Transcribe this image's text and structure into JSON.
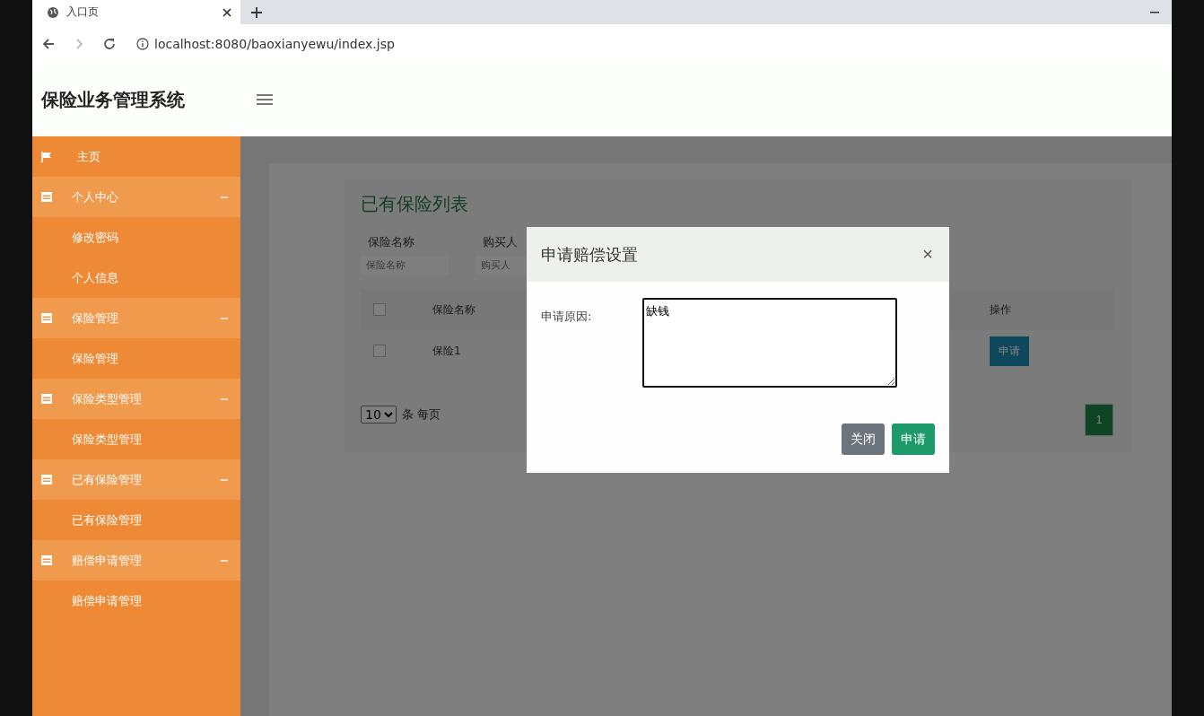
{
  "browser": {
    "tab_title": "入口页",
    "url": "localhost:8080/baoxianyewu/index.jsp"
  },
  "app_title": "保险业务管理系统",
  "sidebar": [
    {
      "label": "主页",
      "kind": "link"
    },
    {
      "label": "个人中心",
      "kind": "group",
      "expanded": true,
      "children": [
        {
          "label": "修改密码"
        },
        {
          "label": "个人信息"
        }
      ]
    },
    {
      "label": "保险管理",
      "kind": "group",
      "expanded": true,
      "children": [
        {
          "label": "保险管理"
        }
      ]
    },
    {
      "label": "保险类型管理",
      "kind": "group",
      "expanded": true,
      "children": [
        {
          "label": "保险类型管理"
        }
      ]
    },
    {
      "label": "已有保险管理",
      "kind": "group",
      "expanded": true,
      "children": [
        {
          "label": "已有保险管理"
        }
      ]
    },
    {
      "label": "赔偿申请管理",
      "kind": "group",
      "expanded": true,
      "children": [
        {
          "label": "赔偿申请管理"
        }
      ]
    }
  ],
  "page": {
    "title": "已有保险列表",
    "search": [
      {
        "label": "保险名称",
        "placeholder": "保险名称"
      },
      {
        "label": "购买人",
        "placeholder": "购买人"
      }
    ],
    "table": {
      "select_all_checked": false,
      "columns": [
        "保险名称",
        "操作"
      ],
      "rows": [
        {
          "checked": false,
          "name": "保险1",
          "action": "申请"
        }
      ]
    },
    "pagination": {
      "page_size": "10",
      "per_page_label": "条 每页",
      "pages": [
        {
          "label": "1",
          "selected": true
        }
      ]
    }
  },
  "modal": {
    "title": "申请赔偿设置",
    "close": "×",
    "field_label": "申请原因:",
    "value": "缺钱",
    "buttons": [
      {
        "label": "关闭",
        "kind": "secondary"
      },
      {
        "label": "申请",
        "kind": "primary"
      }
    ]
  }
}
